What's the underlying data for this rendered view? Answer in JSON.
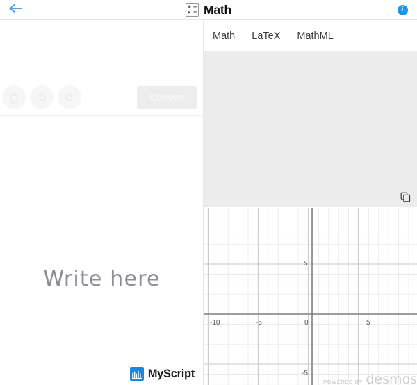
{
  "header": {
    "back_icon": "back-arrow-icon",
    "app_icon": "math-grid-icon",
    "app_icon_symbols": [
      "+",
      "−",
      "×",
      "="
    ],
    "title": "Math",
    "info_icon": "info-icon",
    "info_glyph": "i",
    "accent_color": "#1a97e8"
  },
  "left_panel": {
    "toolbar": {
      "buttons": [
        {
          "name": "erase-button",
          "icon": "trash-icon",
          "label": "",
          "disabled": true
        },
        {
          "name": "undo-button",
          "icon": "undo-icon",
          "label": "",
          "disabled": true
        },
        {
          "name": "redo-button",
          "icon": "redo-icon",
          "label": "",
          "disabled": true
        }
      ],
      "convert_label": "Convert",
      "convert_disabled": true,
      "convert_bg": "#ededed",
      "convert_text_color": "#fafafa"
    },
    "placeholder": "Write here",
    "placeholder_color": "#8c8f95",
    "brand": {
      "mark_icon": "myscript-logo-icon",
      "name": "MyScript",
      "mark_color": "#1a86dd"
    }
  },
  "right_panel": {
    "tabs": [
      {
        "label": "Math",
        "active": true
      },
      {
        "label": "LaTeX",
        "active": false
      },
      {
        "label": "MathML",
        "active": false
      }
    ],
    "result": {
      "value": "",
      "background": "#ececec",
      "copy_icon": "copy-icon"
    },
    "graph": {
      "watermark_prefix": "POWERED BY",
      "watermark_name": "desmos",
      "x_labels": [
        "-10",
        "-5",
        "0",
        "5"
      ],
      "y_labels": [
        "5",
        "-5"
      ],
      "grid_color": "#dddddd",
      "axis_color": "#888888"
    }
  },
  "chart_data": {
    "type": "line",
    "title": "",
    "xlabel": "",
    "ylabel": "",
    "xlim": [
      -11.2,
      7.0
    ],
    "ylim": [
      -7.6,
      7.3
    ],
    "x_ticks": [
      -10,
      -5,
      0,
      5
    ],
    "y_ticks": [
      5,
      -5
    ],
    "x_tick_labels": [
      "-10",
      "-5",
      "0",
      "5"
    ],
    "y_tick_labels": [
      "5",
      "-5"
    ],
    "grid": true,
    "minor_grid_step": 1,
    "major_grid_step": 5,
    "series": [],
    "annotations": [
      "POWERED BY desmos"
    ],
    "legend": "none"
  }
}
